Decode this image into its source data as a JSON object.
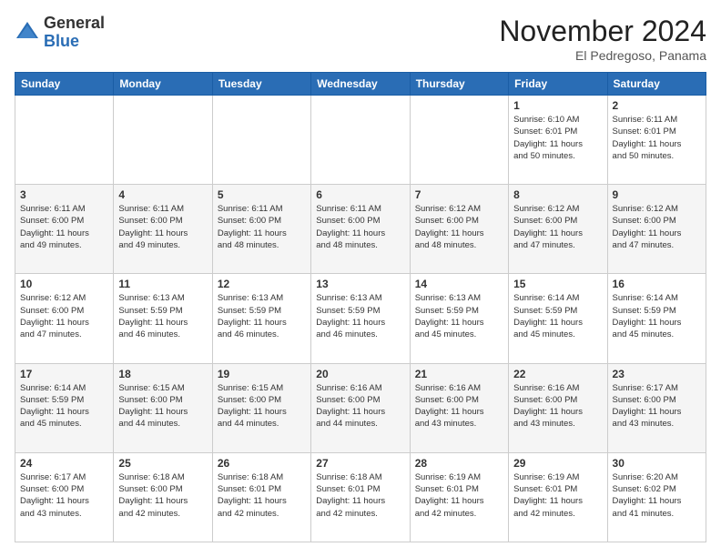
{
  "logo": {
    "general": "General",
    "blue": "Blue"
  },
  "header": {
    "month_title": "November 2024",
    "location": "El Pedregoso, Panama"
  },
  "days_of_week": [
    "Sunday",
    "Monday",
    "Tuesday",
    "Wednesday",
    "Thursday",
    "Friday",
    "Saturday"
  ],
  "weeks": [
    [
      {
        "day": "",
        "info": ""
      },
      {
        "day": "",
        "info": ""
      },
      {
        "day": "",
        "info": ""
      },
      {
        "day": "",
        "info": ""
      },
      {
        "day": "",
        "info": ""
      },
      {
        "day": "1",
        "info": "Sunrise: 6:10 AM\nSunset: 6:01 PM\nDaylight: 11 hours\nand 50 minutes."
      },
      {
        "day": "2",
        "info": "Sunrise: 6:11 AM\nSunset: 6:01 PM\nDaylight: 11 hours\nand 50 minutes."
      }
    ],
    [
      {
        "day": "3",
        "info": "Sunrise: 6:11 AM\nSunset: 6:00 PM\nDaylight: 11 hours\nand 49 minutes."
      },
      {
        "day": "4",
        "info": "Sunrise: 6:11 AM\nSunset: 6:00 PM\nDaylight: 11 hours\nand 49 minutes."
      },
      {
        "day": "5",
        "info": "Sunrise: 6:11 AM\nSunset: 6:00 PM\nDaylight: 11 hours\nand 48 minutes."
      },
      {
        "day": "6",
        "info": "Sunrise: 6:11 AM\nSunset: 6:00 PM\nDaylight: 11 hours\nand 48 minutes."
      },
      {
        "day": "7",
        "info": "Sunrise: 6:12 AM\nSunset: 6:00 PM\nDaylight: 11 hours\nand 48 minutes."
      },
      {
        "day": "8",
        "info": "Sunrise: 6:12 AM\nSunset: 6:00 PM\nDaylight: 11 hours\nand 47 minutes."
      },
      {
        "day": "9",
        "info": "Sunrise: 6:12 AM\nSunset: 6:00 PM\nDaylight: 11 hours\nand 47 minutes."
      }
    ],
    [
      {
        "day": "10",
        "info": "Sunrise: 6:12 AM\nSunset: 6:00 PM\nDaylight: 11 hours\nand 47 minutes."
      },
      {
        "day": "11",
        "info": "Sunrise: 6:13 AM\nSunset: 5:59 PM\nDaylight: 11 hours\nand 46 minutes."
      },
      {
        "day": "12",
        "info": "Sunrise: 6:13 AM\nSunset: 5:59 PM\nDaylight: 11 hours\nand 46 minutes."
      },
      {
        "day": "13",
        "info": "Sunrise: 6:13 AM\nSunset: 5:59 PM\nDaylight: 11 hours\nand 46 minutes."
      },
      {
        "day": "14",
        "info": "Sunrise: 6:13 AM\nSunset: 5:59 PM\nDaylight: 11 hours\nand 45 minutes."
      },
      {
        "day": "15",
        "info": "Sunrise: 6:14 AM\nSunset: 5:59 PM\nDaylight: 11 hours\nand 45 minutes."
      },
      {
        "day": "16",
        "info": "Sunrise: 6:14 AM\nSunset: 5:59 PM\nDaylight: 11 hours\nand 45 minutes."
      }
    ],
    [
      {
        "day": "17",
        "info": "Sunrise: 6:14 AM\nSunset: 5:59 PM\nDaylight: 11 hours\nand 45 minutes."
      },
      {
        "day": "18",
        "info": "Sunrise: 6:15 AM\nSunset: 6:00 PM\nDaylight: 11 hours\nand 44 minutes."
      },
      {
        "day": "19",
        "info": "Sunrise: 6:15 AM\nSunset: 6:00 PM\nDaylight: 11 hours\nand 44 minutes."
      },
      {
        "day": "20",
        "info": "Sunrise: 6:16 AM\nSunset: 6:00 PM\nDaylight: 11 hours\nand 44 minutes."
      },
      {
        "day": "21",
        "info": "Sunrise: 6:16 AM\nSunset: 6:00 PM\nDaylight: 11 hours\nand 43 minutes."
      },
      {
        "day": "22",
        "info": "Sunrise: 6:16 AM\nSunset: 6:00 PM\nDaylight: 11 hours\nand 43 minutes."
      },
      {
        "day": "23",
        "info": "Sunrise: 6:17 AM\nSunset: 6:00 PM\nDaylight: 11 hours\nand 43 minutes."
      }
    ],
    [
      {
        "day": "24",
        "info": "Sunrise: 6:17 AM\nSunset: 6:00 PM\nDaylight: 11 hours\nand 43 minutes."
      },
      {
        "day": "25",
        "info": "Sunrise: 6:18 AM\nSunset: 6:00 PM\nDaylight: 11 hours\nand 42 minutes."
      },
      {
        "day": "26",
        "info": "Sunrise: 6:18 AM\nSunset: 6:01 PM\nDaylight: 11 hours\nand 42 minutes."
      },
      {
        "day": "27",
        "info": "Sunrise: 6:18 AM\nSunset: 6:01 PM\nDaylight: 11 hours\nand 42 minutes."
      },
      {
        "day": "28",
        "info": "Sunrise: 6:19 AM\nSunset: 6:01 PM\nDaylight: 11 hours\nand 42 minutes."
      },
      {
        "day": "29",
        "info": "Sunrise: 6:19 AM\nSunset: 6:01 PM\nDaylight: 11 hours\nand 42 minutes."
      },
      {
        "day": "30",
        "info": "Sunrise: 6:20 AM\nSunset: 6:02 PM\nDaylight: 11 hours\nand 41 minutes."
      }
    ]
  ]
}
